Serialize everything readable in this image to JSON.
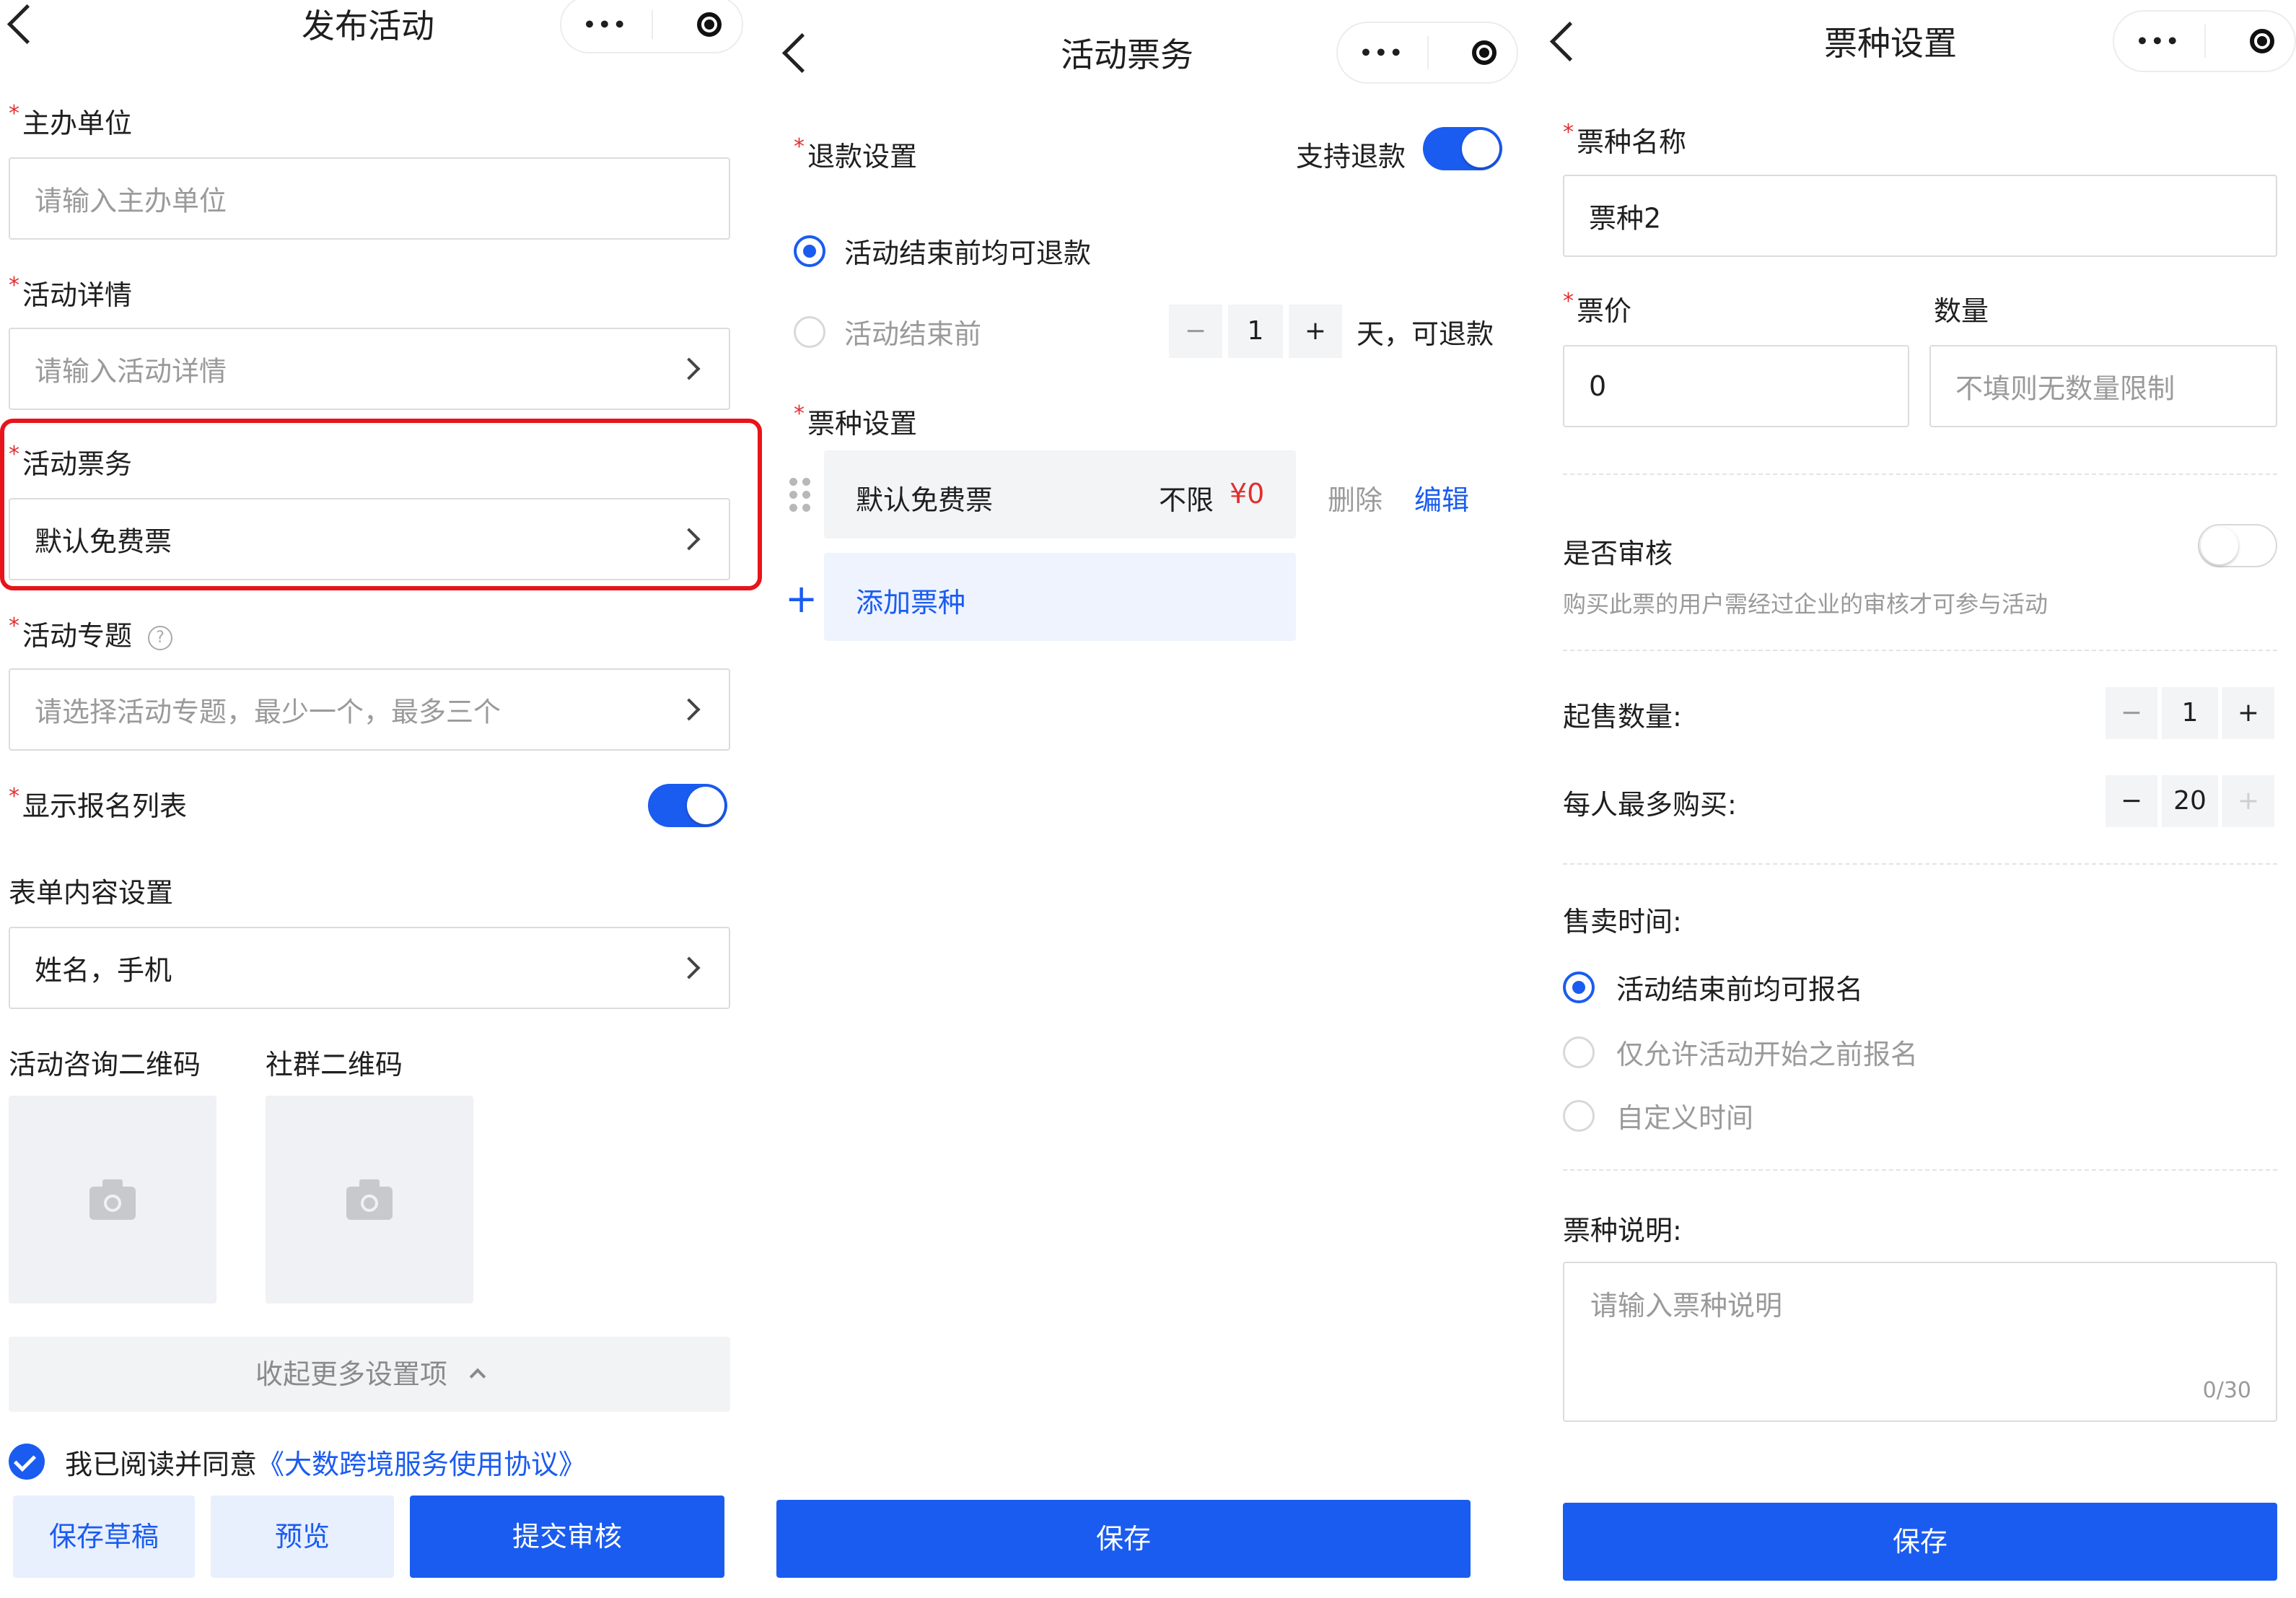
{
  "publish": {
    "title": "发布活动",
    "organizer": {
      "label": "主办单位",
      "placeholder": "请输入主办单位"
    },
    "details": {
      "label": "活动详情",
      "placeholder": "请输入活动详情"
    },
    "tickets": {
      "label": "活动票务",
      "value": "默认免费票"
    },
    "topic": {
      "label": "活动专题",
      "placeholder": "请选择活动专题，最少一个，最多三个"
    },
    "show_signup_list": {
      "label": "显示报名列表",
      "on": true
    },
    "form_content": {
      "label": "表单内容设置",
      "value": "姓名，手机"
    },
    "consult_qr_label": "活动咨询二维码",
    "community_qr_label": "社群二维码",
    "collapse_label": "收起更多设置项",
    "agree_text": "我已阅读并同意",
    "agree_link": "《大数跨境服务使用协议》",
    "save_draft": "保存草稿",
    "preview": "预览",
    "submit": "提交审核"
  },
  "ticketing": {
    "title": "活动票务",
    "refund_label": "退款设置",
    "refund_support_label": "支持退款",
    "refund_on": true,
    "option_all": "活动结束前均可退款",
    "option_before": "活动结束前",
    "days_value": "1",
    "days_suffix": "天，可退款",
    "ticket_types_label": "票种设置",
    "ticket": {
      "name": "默认免费票",
      "limit": "不限",
      "price": "¥0",
      "delete": "删除",
      "edit": "编辑"
    },
    "add_ticket": "添加票种",
    "save": "保存"
  },
  "ticket_settings": {
    "title": "票种设置",
    "name_label": "票种名称",
    "name_value": "票种2",
    "price_label": "票价",
    "price_value": "0",
    "qty_label": "数量",
    "qty_placeholder": "不填则无数量限制",
    "review_label": "是否审核",
    "review_on": false,
    "review_hint": "购买此票的用户需经过企业的审核才可参与活动",
    "min_qty_label": "起售数量:",
    "min_qty_value": "1",
    "max_per_label": "每人最多购买:",
    "max_per_value": "20",
    "sale_time_label": "售卖时间:",
    "sale_options": [
      "活动结束前均可报名",
      "仅允许活动开始之前报名",
      "自定义时间"
    ],
    "desc_label": "票种说明:",
    "desc_placeholder": "请输入票种说明",
    "desc_counter": "0/30",
    "save": "保存"
  },
  "symbols": {
    "minus": "−",
    "plus": "+",
    "dots": "•••",
    "help": "?",
    "chev_up": "⌃"
  },
  "colors": {
    "primary": "#1a5cf0",
    "required": "#e03030",
    "highlight": "#e8131b"
  }
}
